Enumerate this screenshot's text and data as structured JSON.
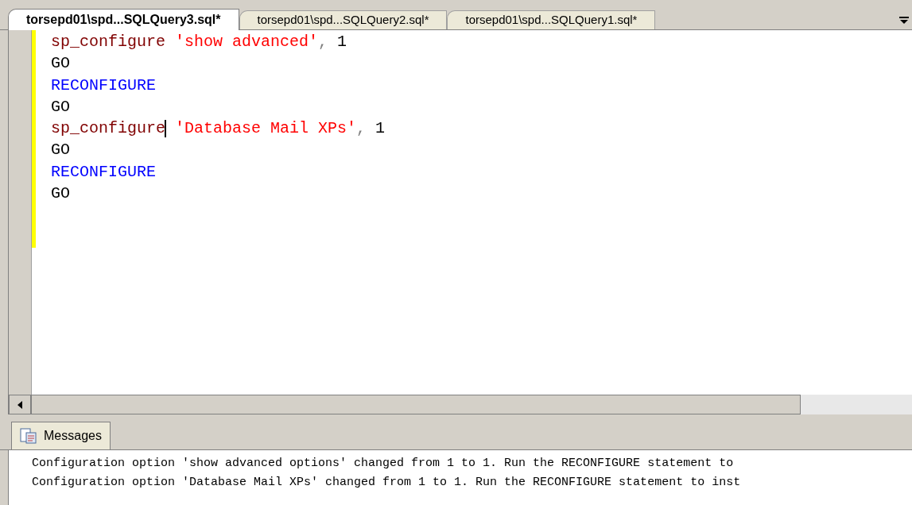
{
  "tabs": [
    {
      "label": "torsepd01\\spd...SQLQuery3.sql*",
      "selected": true
    },
    {
      "label": "torsepd01\\spd...SQLQuery2.sql*",
      "selected": false
    },
    {
      "label": "torsepd01\\spd...SQLQuery1.sql*",
      "selected": false
    }
  ],
  "editor": {
    "lines": [
      {
        "tokens": [
          {
            "kind": "proc",
            "text": "sp_configure"
          },
          {
            "kind": "string",
            "text": " 'show advanced'"
          },
          {
            "kind": "op",
            "text": ","
          },
          {
            "kind": "plain",
            "text": " 1"
          }
        ]
      },
      {
        "tokens": [
          {
            "kind": "plain",
            "text": "GO"
          }
        ]
      },
      {
        "tokens": [
          {
            "kind": "keyword",
            "text": "RECONFIGURE"
          }
        ]
      },
      {
        "tokens": [
          {
            "kind": "plain",
            "text": "GO"
          }
        ]
      },
      {
        "tokens": [
          {
            "kind": "proc",
            "text": "sp_configure",
            "caret_after": true
          },
          {
            "kind": "string",
            "text": " 'Database Mail XPs'"
          },
          {
            "kind": "op",
            "text": ","
          },
          {
            "kind": "plain",
            "text": " 1"
          }
        ]
      },
      {
        "tokens": [
          {
            "kind": "plain",
            "text": "GO"
          }
        ]
      },
      {
        "tokens": [
          {
            "kind": "keyword",
            "text": "RECONFIGURE"
          }
        ]
      },
      {
        "tokens": [
          {
            "kind": "plain",
            "text": "GO"
          }
        ]
      }
    ]
  },
  "results": {
    "tab": {
      "label": "Messages",
      "selected": true
    },
    "messages": [
      "Configuration option 'show advanced options' changed from 1 to 1. Run the RECONFIGURE statement to",
      "Configuration option 'Database Mail XPs' changed from 1 to 1. Run the RECONFIGURE statement to inst"
    ]
  }
}
